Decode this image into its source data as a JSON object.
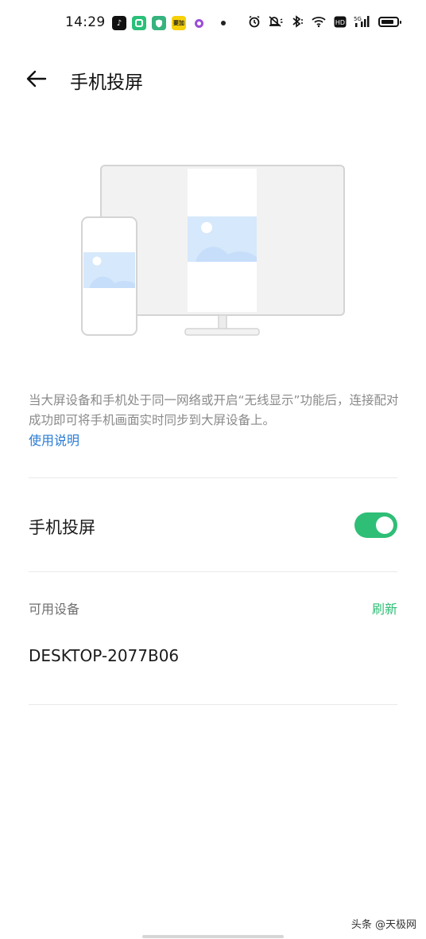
{
  "status_bar": {
    "time": "14:29",
    "yellow_app_label": "要加",
    "icons": [
      "tiktok-icon",
      "chat-icon",
      "shield-icon",
      "yellow-app-icon",
      "ring-icon",
      "dot-icon",
      "alarm-icon",
      "mute-icon",
      "bluetooth-icon",
      "wifi-icon",
      "hd-icon",
      "signal-5g-icon",
      "battery-icon"
    ]
  },
  "header": {
    "back_icon": "arrow-left-icon",
    "title": "手机投屏"
  },
  "illustration": {
    "icon": "phone-to-monitor-illustration"
  },
  "description": {
    "text": "当大屏设备和手机处于同一网络或开启“无线显示”功能后，连接配对成功即可将手机画面实时同步到大屏设备上。",
    "help_link": "使用说明"
  },
  "screencast_toggle": {
    "label": "手机投屏",
    "enabled": true
  },
  "available_devices": {
    "title": "可用设备",
    "refresh_label": "刷新",
    "devices": [
      {
        "name": "DESKTOP-2077B06"
      }
    ]
  },
  "watermark": "头条 @天极网",
  "colors": {
    "accent_green": "#2fbe76",
    "link_blue": "#2a7bd5",
    "secondary_text": "#8a8a8a"
  }
}
